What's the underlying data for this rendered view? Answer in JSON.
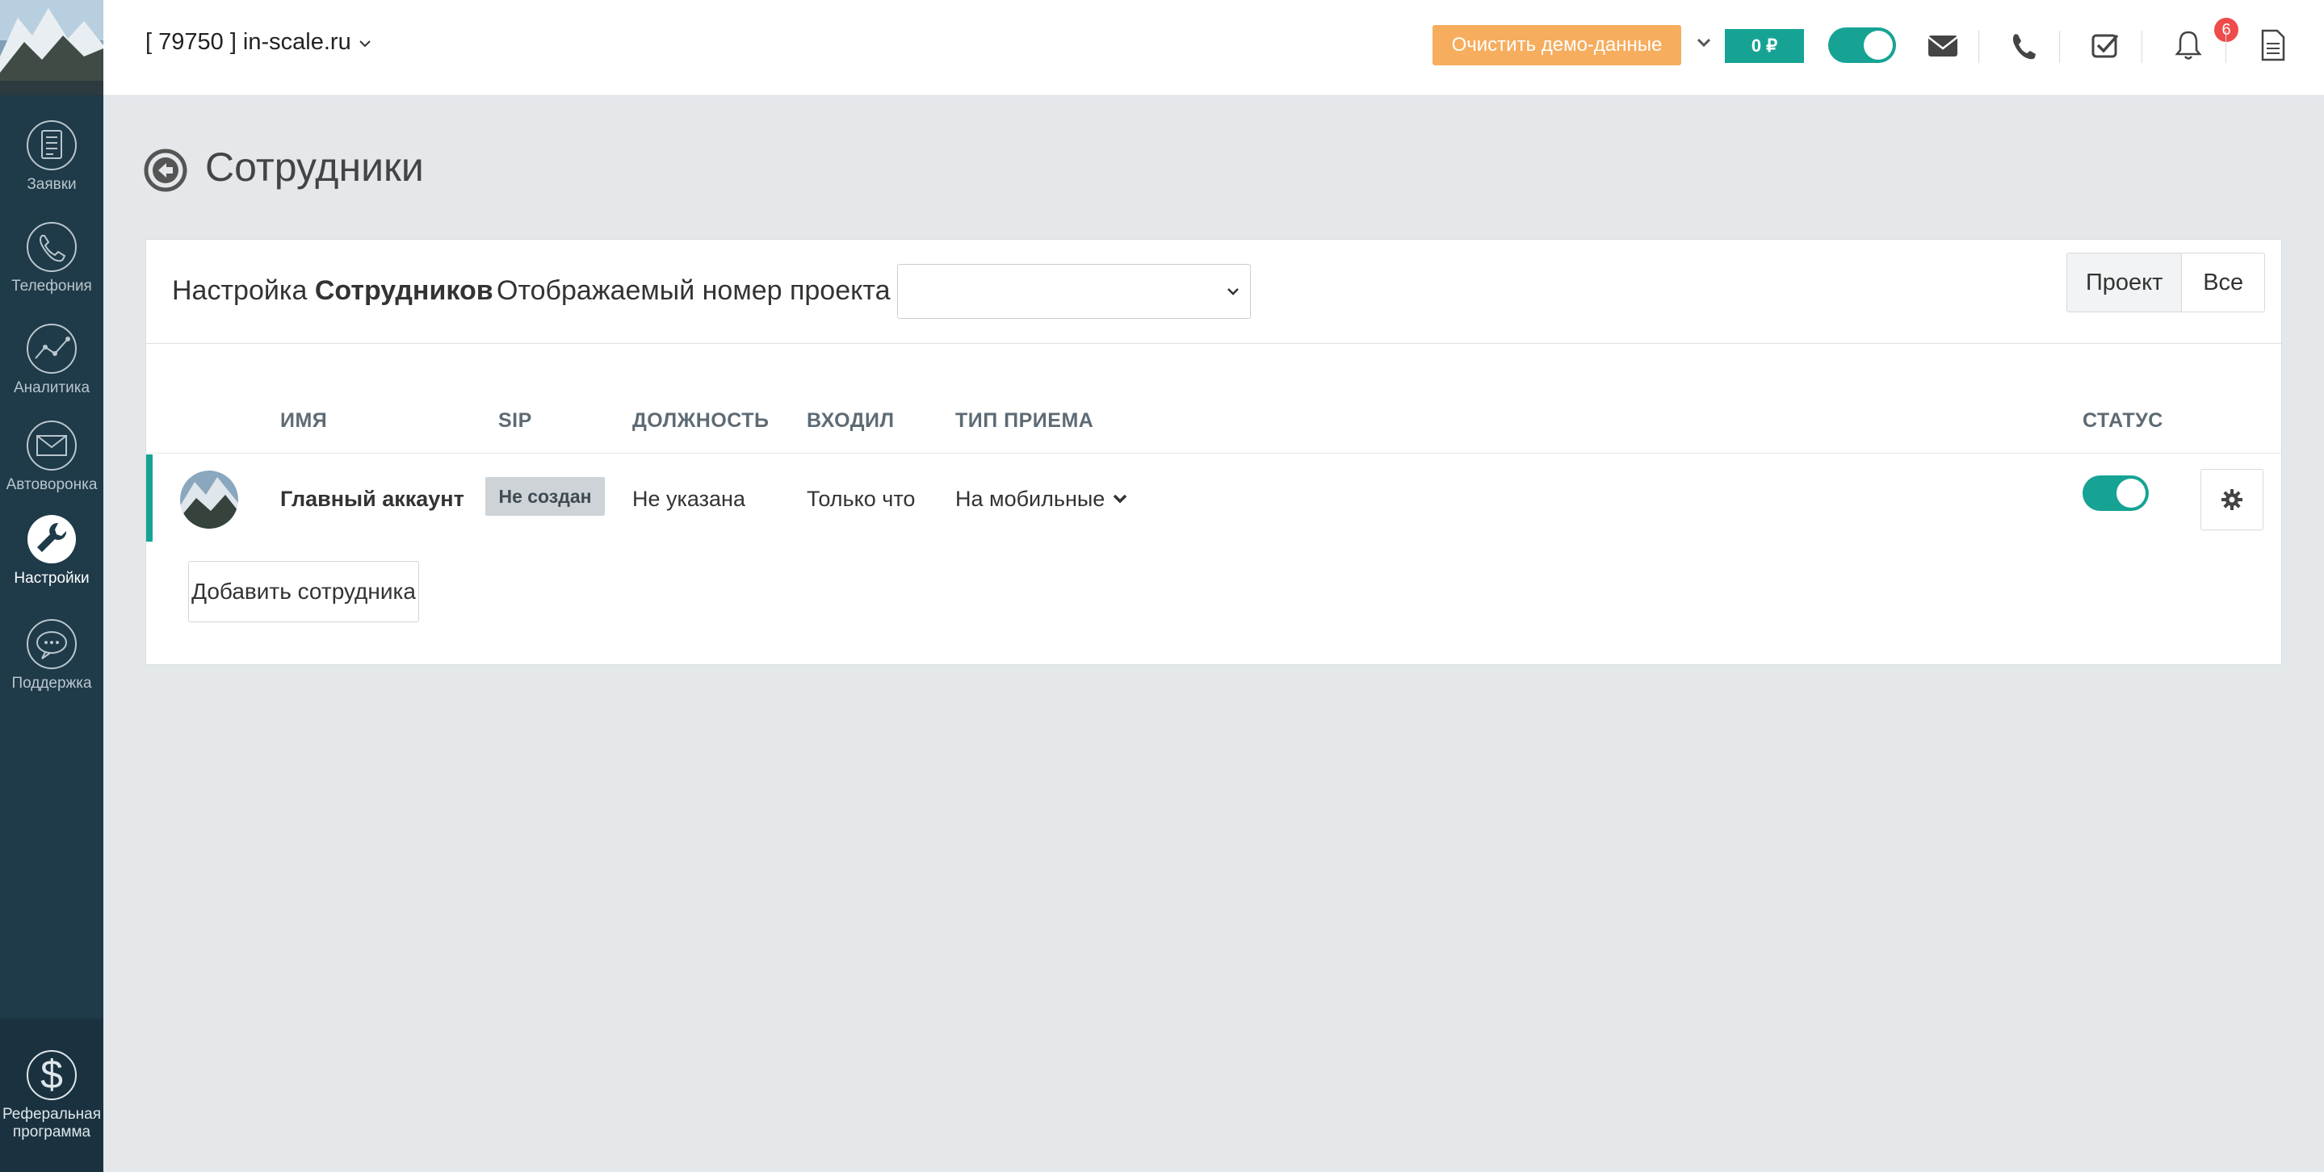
{
  "header": {
    "project_label": "[ 79750 ] in-scale.ru",
    "clear_demo_label": "Очистить демо-данные",
    "balance_label": "0 ₽",
    "tasks_badge": "6"
  },
  "sidebar": {
    "items": [
      {
        "label": "Заявки",
        "icon": "orders-icon"
      },
      {
        "label": "Телефония",
        "icon": "phone-icon"
      },
      {
        "label": "Аналитика",
        "icon": "analytics-icon"
      },
      {
        "label": "Автоворонка",
        "icon": "mail-funnel-icon"
      },
      {
        "label": "Настройки",
        "icon": "wrench-icon",
        "active": true
      },
      {
        "label": "Поддержка",
        "icon": "chat-bubble-icon"
      }
    ],
    "referral_line1": "Реферальная",
    "referral_line2": "программа"
  },
  "page": {
    "title": "Сотрудники"
  },
  "card": {
    "title_prefix": "Настройка",
    "title_bold": "Сотрудников",
    "display_number_label": "Отображаемый номер проекта",
    "select_value": "",
    "segment_project": "Проект",
    "segment_all": "Все"
  },
  "table": {
    "headers": {
      "name": "ИМЯ",
      "sip": "SIP",
      "position": "ДОЛЖНОСТЬ",
      "last_login": "ВХОДИЛ",
      "receive_type": "ТИП ПРИЕМА",
      "status": "СТАТУС"
    },
    "rows": [
      {
        "name": "Главный аккаунт",
        "sip": "Не создан",
        "position": "Не указана",
        "last_login": "Только что",
        "receive_type": "На мобильные",
        "status_on": true
      }
    ],
    "add_button": "Добавить сотрудника"
  },
  "colors": {
    "sidebar": "#1f3a48",
    "accent": "#16a394",
    "orange": "#f6ad5e",
    "badge": "#ef4b4b"
  }
}
